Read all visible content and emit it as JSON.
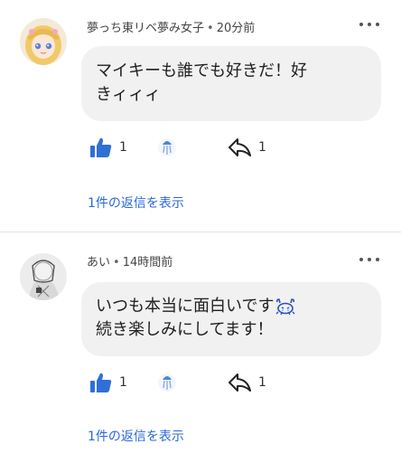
{
  "comments": [
    {
      "author": "夢っち東リベ夢み女子",
      "time": "20分前",
      "separator": "•",
      "lines": [
        "マイキーも誰でも好きだ！好",
        "きィィィ"
      ],
      "like_count": "1",
      "reply_count": "1",
      "view_replies": "1件の返信を表示",
      "avatar": "anime-girl-avatar"
    },
    {
      "author": "あい",
      "time": "14時間前",
      "separator": "•",
      "lines": [
        "いつも本当に面白いです",
        "続き楽しみにしてます！"
      ],
      "emoji": "crying-crab-emoji",
      "like_count": "1",
      "reply_count": "1",
      "view_replies": "1件の返信を表示",
      "avatar": "sketch-avatar"
    }
  ],
  "colors": {
    "like": "#2f6fd6",
    "link": "#2a68d8",
    "bubble": "#f1f1f2"
  }
}
